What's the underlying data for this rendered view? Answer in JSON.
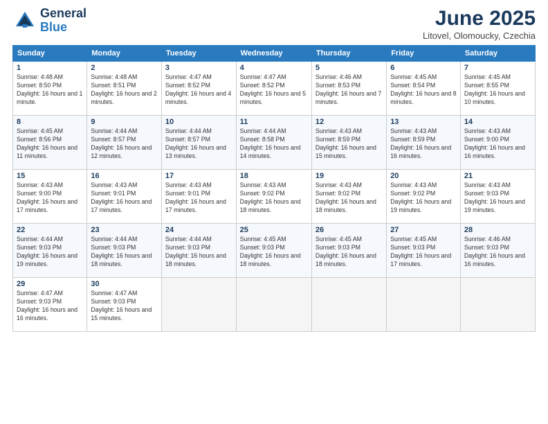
{
  "header": {
    "logo_line1": "General",
    "logo_line2": "Blue",
    "month_title": "June 2025",
    "subtitle": "Litovel, Olomoucky, Czechia"
  },
  "days_of_week": [
    "Sunday",
    "Monday",
    "Tuesday",
    "Wednesday",
    "Thursday",
    "Friday",
    "Saturday"
  ],
  "weeks": [
    [
      {
        "day": "1",
        "info": "Sunrise: 4:48 AM\nSunset: 8:50 PM\nDaylight: 16 hours and 1 minute."
      },
      {
        "day": "2",
        "info": "Sunrise: 4:48 AM\nSunset: 8:51 PM\nDaylight: 16 hours and 2 minutes."
      },
      {
        "day": "3",
        "info": "Sunrise: 4:47 AM\nSunset: 8:52 PM\nDaylight: 16 hours and 4 minutes."
      },
      {
        "day": "4",
        "info": "Sunrise: 4:47 AM\nSunset: 8:52 PM\nDaylight: 16 hours and 5 minutes."
      },
      {
        "day": "5",
        "info": "Sunrise: 4:46 AM\nSunset: 8:53 PM\nDaylight: 16 hours and 7 minutes."
      },
      {
        "day": "6",
        "info": "Sunrise: 4:45 AM\nSunset: 8:54 PM\nDaylight: 16 hours and 8 minutes."
      },
      {
        "day": "7",
        "info": "Sunrise: 4:45 AM\nSunset: 8:55 PM\nDaylight: 16 hours and 10 minutes."
      }
    ],
    [
      {
        "day": "8",
        "info": "Sunrise: 4:45 AM\nSunset: 8:56 PM\nDaylight: 16 hours and 11 minutes."
      },
      {
        "day": "9",
        "info": "Sunrise: 4:44 AM\nSunset: 8:57 PM\nDaylight: 16 hours and 12 minutes."
      },
      {
        "day": "10",
        "info": "Sunrise: 4:44 AM\nSunset: 8:57 PM\nDaylight: 16 hours and 13 minutes."
      },
      {
        "day": "11",
        "info": "Sunrise: 4:44 AM\nSunset: 8:58 PM\nDaylight: 16 hours and 14 minutes."
      },
      {
        "day": "12",
        "info": "Sunrise: 4:43 AM\nSunset: 8:59 PM\nDaylight: 16 hours and 15 minutes."
      },
      {
        "day": "13",
        "info": "Sunrise: 4:43 AM\nSunset: 8:59 PM\nDaylight: 16 hours and 16 minutes."
      },
      {
        "day": "14",
        "info": "Sunrise: 4:43 AM\nSunset: 9:00 PM\nDaylight: 16 hours and 16 minutes."
      }
    ],
    [
      {
        "day": "15",
        "info": "Sunrise: 4:43 AM\nSunset: 9:00 PM\nDaylight: 16 hours and 17 minutes."
      },
      {
        "day": "16",
        "info": "Sunrise: 4:43 AM\nSunset: 9:01 PM\nDaylight: 16 hours and 17 minutes."
      },
      {
        "day": "17",
        "info": "Sunrise: 4:43 AM\nSunset: 9:01 PM\nDaylight: 16 hours and 17 minutes."
      },
      {
        "day": "18",
        "info": "Sunrise: 4:43 AM\nSunset: 9:02 PM\nDaylight: 16 hours and 18 minutes."
      },
      {
        "day": "19",
        "info": "Sunrise: 4:43 AM\nSunset: 9:02 PM\nDaylight: 16 hours and 18 minutes."
      },
      {
        "day": "20",
        "info": "Sunrise: 4:43 AM\nSunset: 9:02 PM\nDaylight: 16 hours and 19 minutes."
      },
      {
        "day": "21",
        "info": "Sunrise: 4:43 AM\nSunset: 9:03 PM\nDaylight: 16 hours and 19 minutes."
      }
    ],
    [
      {
        "day": "22",
        "info": "Sunrise: 4:44 AM\nSunset: 9:03 PM\nDaylight: 16 hours and 19 minutes."
      },
      {
        "day": "23",
        "info": "Sunrise: 4:44 AM\nSunset: 9:03 PM\nDaylight: 16 hours and 18 minutes."
      },
      {
        "day": "24",
        "info": "Sunrise: 4:44 AM\nSunset: 9:03 PM\nDaylight: 16 hours and 18 minutes."
      },
      {
        "day": "25",
        "info": "Sunrise: 4:45 AM\nSunset: 9:03 PM\nDaylight: 16 hours and 18 minutes."
      },
      {
        "day": "26",
        "info": "Sunrise: 4:45 AM\nSunset: 9:03 PM\nDaylight: 16 hours and 18 minutes."
      },
      {
        "day": "27",
        "info": "Sunrise: 4:45 AM\nSunset: 9:03 PM\nDaylight: 16 hours and 17 minutes."
      },
      {
        "day": "28",
        "info": "Sunrise: 4:46 AM\nSunset: 9:03 PM\nDaylight: 16 hours and 16 minutes."
      }
    ],
    [
      {
        "day": "29",
        "info": "Sunrise: 4:47 AM\nSunset: 9:03 PM\nDaylight: 16 hours and 16 minutes."
      },
      {
        "day": "30",
        "info": "Sunrise: 4:47 AM\nSunset: 9:03 PM\nDaylight: 16 hours and 15 minutes."
      },
      null,
      null,
      null,
      null,
      null
    ]
  ]
}
